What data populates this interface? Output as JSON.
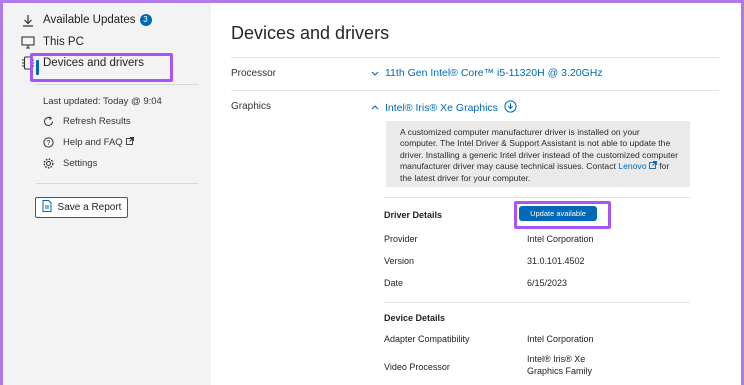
{
  "sidebar": {
    "available_updates": "Available Updates",
    "updates_count": "3",
    "this_pc": "This PC",
    "devices_and_drivers": "Devices and drivers",
    "last_updated": "Last updated: Today @ 9:04",
    "refresh_results": "Refresh Results",
    "help_faq": "Help and FAQ",
    "settings": "Settings",
    "save_report": "Save a Report"
  },
  "main": {
    "title": "Devices and drivers",
    "processor_label": "Processor",
    "processor_value": "11th Gen Intel® Core™ i5-11320H @ 3.20GHz",
    "graphics_label": "Graphics",
    "graphics_value": "Intel® Iris® Xe Graphics",
    "info_text": "A customized computer manufacturer driver is installed on your computer. The Intel Driver & Support Assistant is not able to update the driver. Installing a generic Intel driver instead of the customized computer manufacturer driver may cause technical issues. Contact",
    "info_link": "Lenovo",
    "info_tail": "for the latest driver for your computer.",
    "driver_details": {
      "heading": "Driver Details",
      "update_button": "Update available",
      "provider_label": "Provider",
      "provider_value": "Intel Corporation",
      "version_label": "Version",
      "version_value": "31.0.101.4502",
      "date_label": "Date",
      "date_value": "6/15/2023"
    },
    "device_details": {
      "heading": "Device Details",
      "adapter_label": "Adapter Compatibility",
      "adapter_value": "Intel Corporation",
      "video_label": "Video Processor",
      "video_value_line1": "Intel® Iris® Xe",
      "video_value_line2": "Graphics Family"
    }
  },
  "colors": {
    "accent": "#0068b5",
    "highlight": "#a855f7",
    "sidebar_bg": "#f3f3f3"
  },
  "icons": [
    "download-icon",
    "monitor-icon",
    "chip-icon",
    "refresh-icon",
    "help-icon",
    "external-link-icon",
    "gear-icon",
    "document-icon",
    "chevron-down-icon",
    "chevron-up-icon",
    "download-circle-icon"
  ]
}
